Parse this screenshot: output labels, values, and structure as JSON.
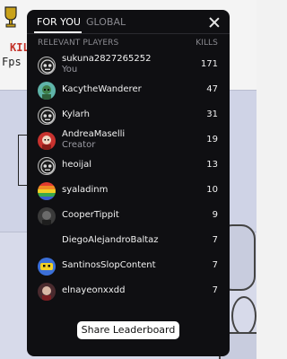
{
  "background": {
    "kills_label": "KIL",
    "fps_label": "Fps"
  },
  "tabs": [
    {
      "label": "FOR YOU",
      "active": true
    },
    {
      "label": "GLOBAL",
      "active": false
    }
  ],
  "close_icon": "close-x-icon",
  "columns": {
    "players": "RELEVANT PLAYERS",
    "kills": "KILLS"
  },
  "players": [
    {
      "name": "sukuna2827265252",
      "subtitle": "You",
      "kills": "171",
      "avatar": "robot-face-icon"
    },
    {
      "name": "KacytheWanderer",
      "subtitle": "",
      "kills": "47",
      "avatar": "green-character-icon"
    },
    {
      "name": "Kylarh",
      "subtitle": "",
      "kills": "31",
      "avatar": "robot-face-icon"
    },
    {
      "name": "AndreaMaselli",
      "subtitle": "Creator",
      "kills": "19",
      "avatar": "red-character-icon"
    },
    {
      "name": "heoijal",
      "subtitle": "",
      "kills": "13",
      "avatar": "robot-face-icon"
    },
    {
      "name": "syaladinm",
      "subtitle": "",
      "kills": "10",
      "avatar": "rainbow-character-icon"
    },
    {
      "name": "CooperTippit",
      "subtitle": "",
      "kills": "9",
      "avatar": "dark-character-icon"
    },
    {
      "name": "DiegoAlejandroBaltaz",
      "subtitle": "",
      "kills": "7",
      "avatar": "none"
    },
    {
      "name": "SantinosSlopContent",
      "subtitle": "",
      "kills": "7",
      "avatar": "blue-character-icon"
    },
    {
      "name": "elnayeonxxdd",
      "subtitle": "",
      "kills": "7",
      "avatar": "dark-red-character-icon"
    }
  ],
  "share_button": "Share Leaderboard",
  "colors": {
    "panel": "#0f0f12",
    "text": "#f2f2f2",
    "muted": "#8a8a90",
    "button": "#ffffff"
  }
}
